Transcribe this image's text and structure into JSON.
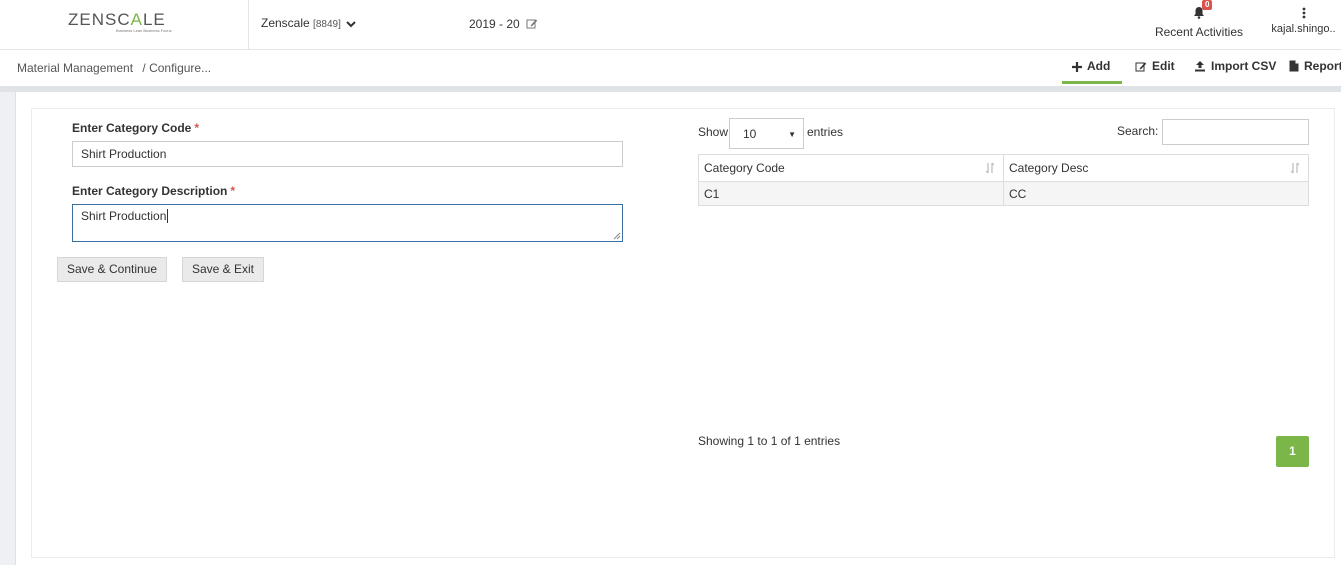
{
  "header": {
    "logo": {
      "word_part1": "ZENSC",
      "word_part2": "A",
      "word_part3": "LE",
      "tagline": "Business Lean Business Focus"
    },
    "company": {
      "name": "Zenscale",
      "code": "[8849]"
    },
    "year": "2019 - 20",
    "recent": {
      "badge": "0",
      "label": "Recent Activities"
    },
    "user": {
      "label": "kajal.shingo.."
    }
  },
  "subbar": {
    "breadcrumb": [
      "Material Management",
      "/ Configure..."
    ],
    "actions": {
      "add": "Add",
      "edit": "Edit",
      "import": "Import CSV",
      "report": "Report"
    }
  },
  "form": {
    "code_label": "Enter Category Code",
    "code_value": "Shirt Production",
    "desc_label": "Enter Category Description",
    "desc_value": "Shirt Production",
    "required_mark": "*",
    "save_continue": "Save & Continue",
    "save_exit": "Save & Exit"
  },
  "table": {
    "show_label": "Show",
    "page_length": "10",
    "entries_label": "entries",
    "search_label": "Search:",
    "columns": [
      "Category Code",
      "Category Desc"
    ],
    "rows": [
      [
        "C1",
        "CC"
      ]
    ],
    "info": "Showing 1 to 1 of 1 entries",
    "current_page": "1"
  },
  "colors": {
    "accent": "#7ab648",
    "badge": "#d9534f",
    "focus": "#3b6fa3"
  }
}
